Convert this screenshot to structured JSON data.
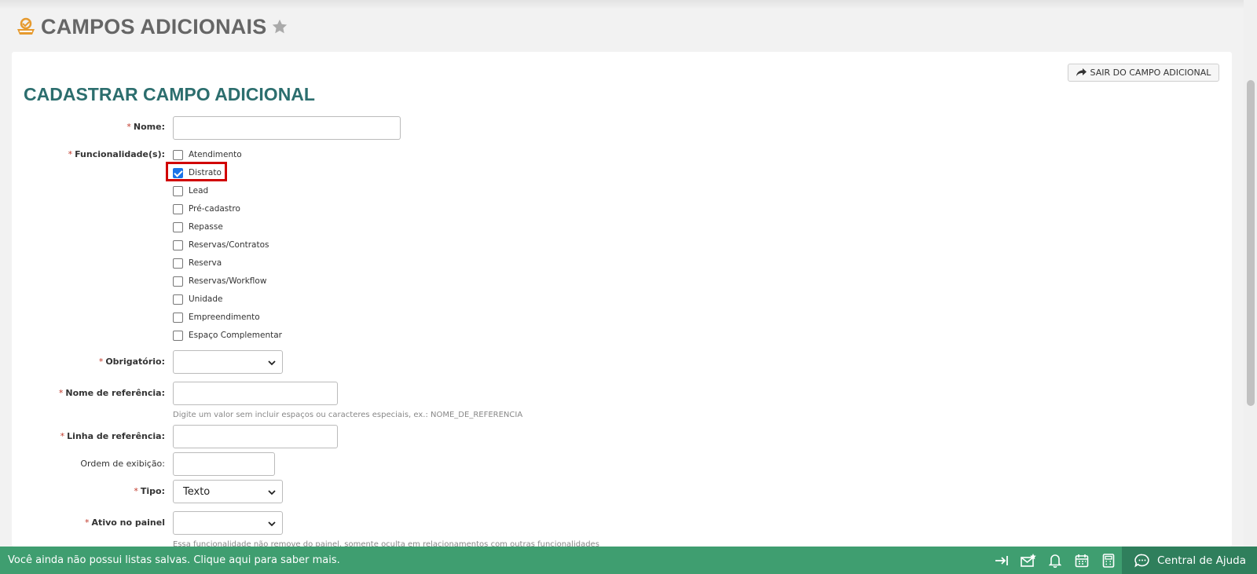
{
  "header": {
    "title": "CAMPOS ADICIONAIS"
  },
  "form": {
    "title": "CADASTRAR CAMPO ADICIONAL",
    "exit_label": "SAIR DO CAMPO ADICIONAL",
    "required_marker": "*",
    "fields": {
      "nome": {
        "label": "Nome:",
        "value": ""
      },
      "funcionalidades": {
        "label": "Funcionalidade(s):"
      },
      "obrigatorio": {
        "label": "Obrigatório:",
        "value": ""
      },
      "nome_referencia": {
        "label": "Nome de referência:",
        "value": "",
        "hint": "Digite um valor sem incluir espaços ou caracteres especiais, ex.: NOME_DE_REFERENCIA"
      },
      "linha_referencia": {
        "label": "Linha de referência:",
        "value": ""
      },
      "ordem_exibicao": {
        "label": "Ordem de exibição:",
        "value": ""
      },
      "tipo": {
        "label": "Tipo:",
        "value": "Texto"
      },
      "ativo_painel": {
        "label": "Ativo no painel",
        "value": "",
        "hint": "Essa funcionalidade não remove do painel, somente oculta em relacionamentos com outras funcionalidades"
      }
    },
    "options": [
      {
        "label": "Atendimento",
        "checked": false
      },
      {
        "label": "Distrato",
        "checked": true
      },
      {
        "label": "Lead",
        "checked": false
      },
      {
        "label": "Pré-cadastro",
        "checked": false
      },
      {
        "label": "Repasse",
        "checked": false
      },
      {
        "label": "Reservas/Contratos",
        "checked": false
      },
      {
        "label": "Reserva",
        "checked": false
      },
      {
        "label": "Reservas/Workflow",
        "checked": false
      },
      {
        "label": "Unidade",
        "checked": false
      },
      {
        "label": "Empreendimento",
        "checked": false
      },
      {
        "label": "Espaço Complementar",
        "checked": false
      }
    ]
  },
  "bottom_bar": {
    "message": "Você ainda não possui listas salvas. Clique aqui para saber mais.",
    "help_label": "Central de Ajuda",
    "icons": [
      "collapse-arrow-icon",
      "mail-star-icon",
      "bell-icon",
      "calendar-icon",
      "calculator-icon",
      "chat-icon"
    ]
  },
  "colors": {
    "accent": "#2c6e6e",
    "bar": "#3f9e70",
    "bar_dark": "#2f7f5c",
    "required": "#c0392b",
    "highlight": "#d10000"
  }
}
